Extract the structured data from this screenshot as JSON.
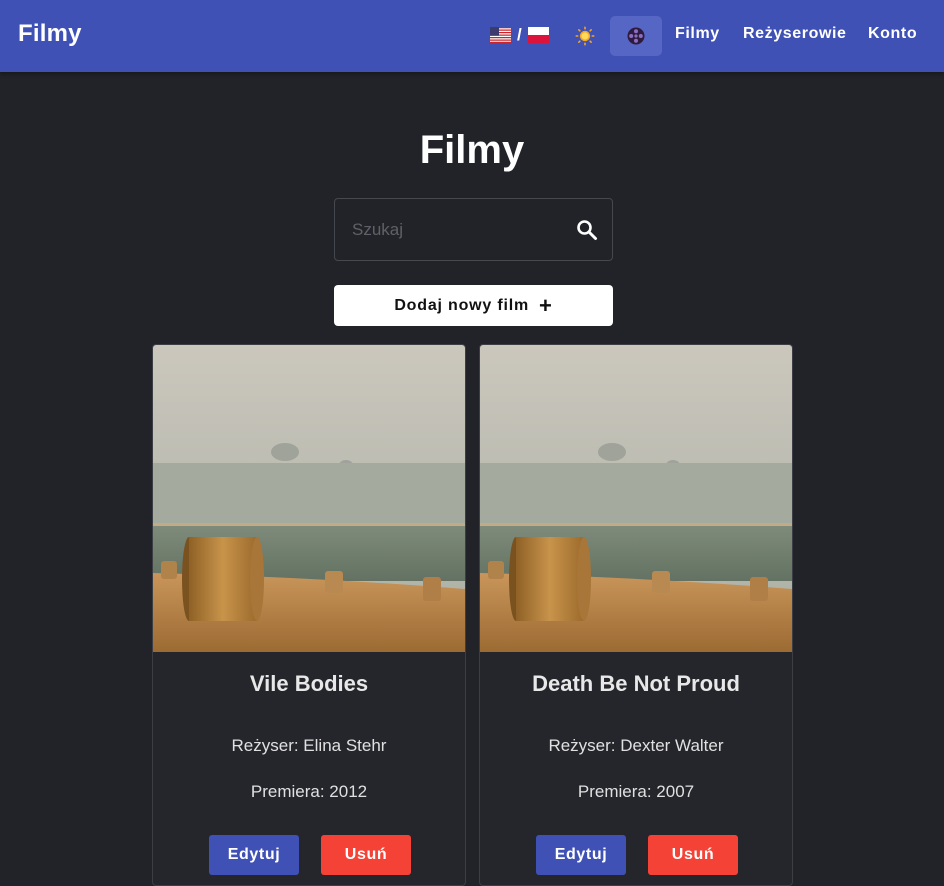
{
  "header": {
    "brand": "Filmy",
    "language_separator": "/",
    "nav": [
      "Filmy",
      "Reżyserowie",
      "Konto"
    ]
  },
  "icons": {
    "flag_us": "us-flag-icon",
    "flag_pl": "pl-flag-icon",
    "theme": "sun-icon",
    "film": "film-reel-icon",
    "search": "search-icon"
  },
  "colors": {
    "header": "#3f51b5",
    "background": "#212328",
    "edit_button": "#3f51b5",
    "delete_button": "#f44336"
  },
  "main": {
    "title": "Filmy",
    "search_placeholder": "Szukaj",
    "search_value": "",
    "add_button_label": "Dodaj nowy film",
    "add_button_icon": "+"
  },
  "movies": [
    {
      "title": "Vile Bodies",
      "director": "Reżyser: Elina Stehr",
      "premiere": "Premiera: 2012",
      "edit_label": "Edytuj",
      "delete_label": "Usuń"
    },
    {
      "title": "Death Be Not Proud",
      "director": "Reżyser: Dexter Walter",
      "premiere": "Premiera: 2007",
      "edit_label": "Edytuj",
      "delete_label": "Usuń"
    }
  ]
}
